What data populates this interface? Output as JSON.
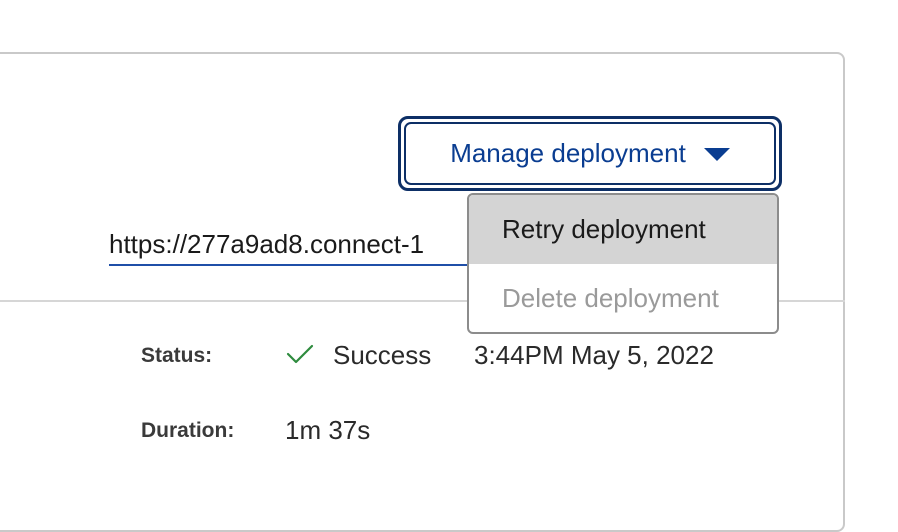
{
  "header": {
    "manage_label": "Manage deployment",
    "url": "https://277a9ad8.connect-1"
  },
  "menu": {
    "items": [
      {
        "label": "Retry deployment",
        "state": "highlighted"
      },
      {
        "label": "Delete deployment",
        "state": "disabled"
      }
    ]
  },
  "details": {
    "status_label": "Status:",
    "status_value": "Success",
    "status_time": "3:44PM May 5, 2022",
    "duration_label": "Duration:",
    "duration_value": "1m 37s"
  },
  "icons": {
    "dropdown": "caret-down-icon",
    "status": "checkmark-icon"
  },
  "colors": {
    "accent": "#0a3d91",
    "button_border": "#0d2f66",
    "success": "#2e8b3e",
    "menu_highlight": "#d4d4d4",
    "disabled_text": "#9a9a9a"
  }
}
